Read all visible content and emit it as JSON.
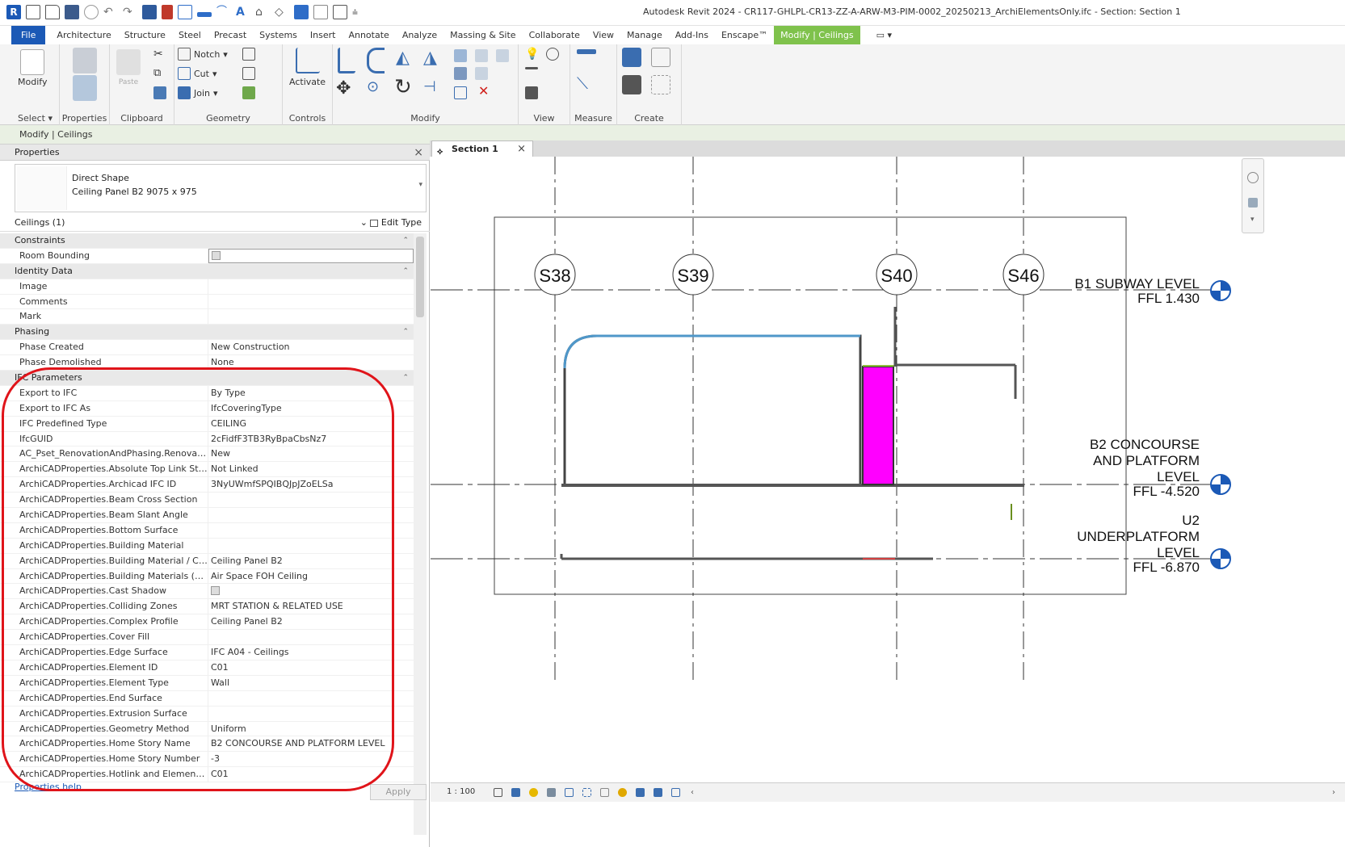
{
  "window": {
    "title": "Autodesk Revit 2024 - CR117-GHLPL-CR13-ZZ-A-ARW-M3-PIM-0002_20250213_ArchiElementsOnly.ifc - Section: Section 1",
    "logo": "R"
  },
  "ribbon_tabs": [
    "File",
    "Architecture",
    "Structure",
    "Steel",
    "Precast",
    "Systems",
    "Insert",
    "Annotate",
    "Analyze",
    "Massing & Site",
    "Collaborate",
    "View",
    "Manage",
    "Add-Ins",
    "Enscape™",
    "Modify | Ceilings"
  ],
  "ribbon": {
    "select": {
      "modify": "Modify",
      "label": "Select ▾"
    },
    "properties": {
      "label": "Properties"
    },
    "clipboard": {
      "paste": "Paste",
      "label": "Clipboard"
    },
    "geometry": {
      "notch": "Notch",
      "cut": "Cut",
      "join": "Join",
      "label": "Geometry"
    },
    "controls": {
      "activate": "Activate",
      "label": "Controls"
    },
    "modify": {
      "label": "Modify"
    },
    "view": {
      "label": "View"
    },
    "measure": {
      "label": "Measure"
    },
    "create": {
      "label": "Create"
    }
  },
  "context_bar": "Modify | Ceilings",
  "properties": {
    "header": "Properties",
    "type_family": "Direct Shape",
    "type_name": "Ceiling Panel B2 9075 x 975",
    "instance_filter": "Ceilings (1)",
    "edit_type": "Edit Type",
    "help": "Properties help",
    "apply": "Apply",
    "rows": [
      {
        "kind": "group",
        "name": "Constraints"
      },
      {
        "kind": "check",
        "name": "Room Bounding",
        "value": ""
      },
      {
        "kind": "group",
        "name": "Identity Data"
      },
      {
        "kind": "row",
        "name": "Image",
        "value": ""
      },
      {
        "kind": "row",
        "name": "Comments",
        "value": ""
      },
      {
        "kind": "row",
        "name": "Mark",
        "value": ""
      },
      {
        "kind": "group",
        "name": "Phasing"
      },
      {
        "kind": "row",
        "name": "Phase Created",
        "value": "New Construction"
      },
      {
        "kind": "row",
        "name": "Phase Demolished",
        "value": "None"
      },
      {
        "kind": "group",
        "name": "IFC Parameters"
      },
      {
        "kind": "row",
        "name": "Export to IFC",
        "value": "By Type"
      },
      {
        "kind": "row",
        "name": "Export to IFC As",
        "value": "IfcCoveringType"
      },
      {
        "kind": "row",
        "name": "IFC Predefined Type",
        "value": "CEILING"
      },
      {
        "kind": "row",
        "name": "IfcGUID",
        "value": "2cFidfF3TB3RyBpaCbsNz7"
      },
      {
        "kind": "row",
        "name": "AC_Pset_RenovationAndPhasing.Renovatio...",
        "value": "New"
      },
      {
        "kind": "row",
        "name": "ArchiCADProperties.Absolute Top Link Story",
        "value": "Not Linked"
      },
      {
        "kind": "row",
        "name": "ArchiCADProperties.Archicad IFC ID",
        "value": "3NyUWmfSPQIBQJpJZoELSa"
      },
      {
        "kind": "row",
        "name": "ArchiCADProperties.Beam Cross Section",
        "value": ""
      },
      {
        "kind": "row",
        "name": "ArchiCADProperties.Beam Slant Angle",
        "value": ""
      },
      {
        "kind": "row",
        "name": "ArchiCADProperties.Bottom Surface",
        "value": ""
      },
      {
        "kind": "row",
        "name": "ArchiCADProperties.Building Material",
        "value": ""
      },
      {
        "kind": "row",
        "name": "ArchiCADProperties.Building Material / Co...",
        "value": "Ceiling Panel B2"
      },
      {
        "kind": "row",
        "name": "ArchiCADProperties.Building Materials (All)",
        "value": "Air Space FOH Ceiling"
      },
      {
        "kind": "check",
        "name": "ArchiCADProperties.Cast Shadow",
        "value": ""
      },
      {
        "kind": "row",
        "name": "ArchiCADProperties.Colliding Zones",
        "value": "MRT STATION & RELATED USE"
      },
      {
        "kind": "row",
        "name": "ArchiCADProperties.Complex Profile",
        "value": "Ceiling Panel B2"
      },
      {
        "kind": "row",
        "name": "ArchiCADProperties.Cover Fill",
        "value": ""
      },
      {
        "kind": "row",
        "name": "ArchiCADProperties.Edge Surface",
        "value": "IFC A04 - Ceilings"
      },
      {
        "kind": "row",
        "name": "ArchiCADProperties.Element ID",
        "value": "C01"
      },
      {
        "kind": "row",
        "name": "ArchiCADProperties.Element Type",
        "value": "Wall"
      },
      {
        "kind": "row",
        "name": "ArchiCADProperties.End Surface",
        "value": ""
      },
      {
        "kind": "row",
        "name": "ArchiCADProperties.Extrusion Surface",
        "value": ""
      },
      {
        "kind": "row",
        "name": "ArchiCADProperties.Geometry Method",
        "value": "Uniform"
      },
      {
        "kind": "row",
        "name": "ArchiCADProperties.Home Story Name",
        "value": "B2 CONCOURSE AND PLATFORM LEVEL"
      },
      {
        "kind": "row",
        "name": "ArchiCADProperties.Home Story Number",
        "value": "-3"
      },
      {
        "kind": "row",
        "name": "ArchiCADProperties.Hotlink and Element ID",
        "value": "C01"
      }
    ]
  },
  "view": {
    "tab": "Section 1",
    "scale": "1 : 100",
    "grids": [
      "S38",
      "S39",
      "S40",
      "S46"
    ],
    "levels": [
      {
        "name_lines": [
          "B1 SUBWAY LEVEL"
        ],
        "elev": "FFL 1.430"
      },
      {
        "name_lines": [
          "B2 CONCOURSE",
          "AND PLATFORM",
          "LEVEL"
        ],
        "elev": "FFL -4.520"
      },
      {
        "name_lines": [
          "U2",
          "UNDERPLATFORM",
          "LEVEL"
        ],
        "elev": "FFL -6.870"
      }
    ],
    "colors": {
      "selected_ceiling": "#4f97c9",
      "highlight": "#ff00ff",
      "grid": "#333333",
      "annotation_circle_blue": "#1b59b6"
    }
  }
}
